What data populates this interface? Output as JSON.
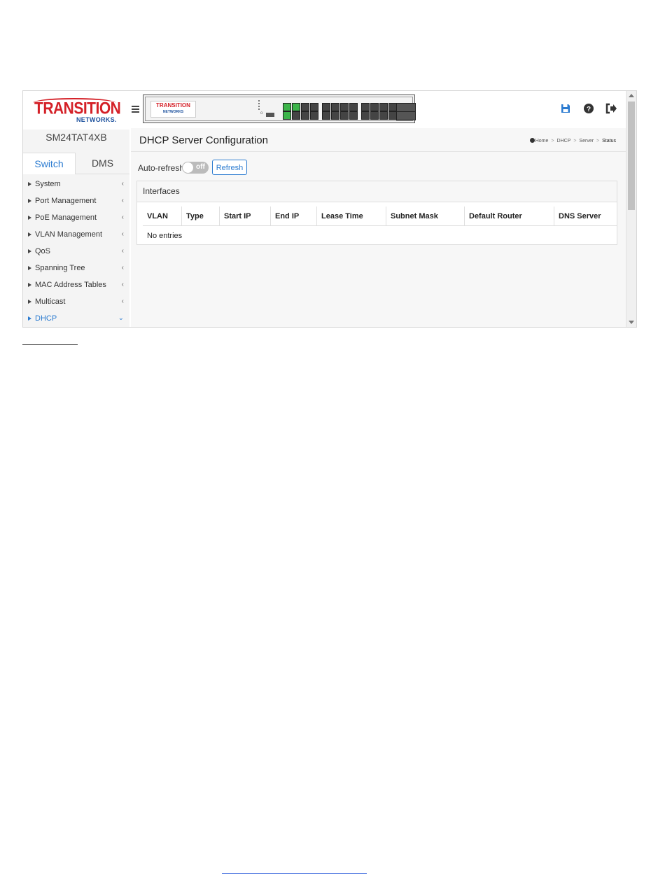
{
  "brand": {
    "logo_main": "TRANSITION",
    "logo_sub": "NETWORKS.",
    "device_logo_main": "TRANSITION",
    "device_logo_sub": "NETWORKS"
  },
  "sidebar": {
    "model": "SM24TAT4XB",
    "tabs": [
      {
        "label": "Switch",
        "active": true
      },
      {
        "label": "DMS",
        "active": false
      }
    ],
    "items": [
      {
        "label": "System",
        "icon": "chevron-left-icon"
      },
      {
        "label": "Port Management",
        "icon": "chevron-left-icon"
      },
      {
        "label": "PoE Management",
        "icon": "chevron-left-icon"
      },
      {
        "label": "VLAN Management",
        "icon": "chevron-left-icon"
      },
      {
        "label": "QoS",
        "icon": "chevron-left-icon"
      },
      {
        "label": "Spanning Tree",
        "icon": "chevron-left-icon"
      },
      {
        "label": "MAC Address Tables",
        "icon": "chevron-left-icon"
      },
      {
        "label": "Multicast",
        "icon": "chevron-left-icon"
      },
      {
        "label": "DHCP",
        "icon": "chevron-down-icon",
        "active": true
      }
    ]
  },
  "toolbar": {
    "icons": [
      "save-icon",
      "help-icon",
      "logout-icon"
    ],
    "accent_color": "#2b7bd0"
  },
  "page": {
    "title": "DHCP Server Configuration",
    "breadcrumb": [
      "Home",
      "DHCP",
      "Server",
      "Status"
    ],
    "auto_refresh_label": "Auto-refresh",
    "auto_refresh_state": "off",
    "refresh_button": "Refresh"
  },
  "interfaces": {
    "title": "Interfaces",
    "columns": [
      "VLAN",
      "Type",
      "Start IP",
      "End IP",
      "Lease Time",
      "Subnet Mask",
      "Default Router",
      "DNS Server"
    ],
    "empty_text": "No entries"
  }
}
